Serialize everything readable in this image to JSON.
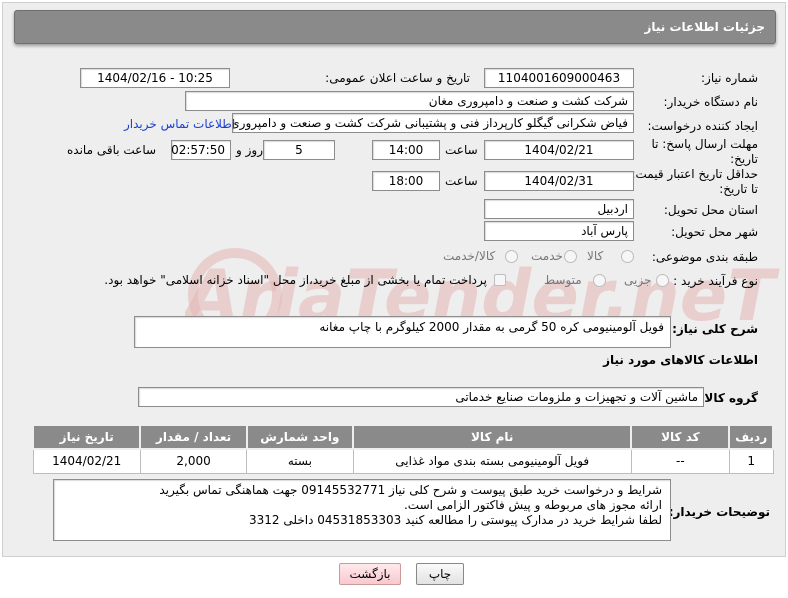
{
  "header": {
    "title": "جزئیات اطلاعات نیاز"
  },
  "fields": {
    "need_number_label": "شماره نیاز:",
    "need_number": "1104001609000463",
    "announce_label": "تاریخ و ساعت اعلان عمومی:",
    "announce_value": "1404/02/16 - 10:25",
    "buyer_org_label": "نام دستگاه خریدار:",
    "buyer_org": "شرکت کشت و صنعت و دامپروری مغان",
    "creator_label": "ایجاد کننده درخواست:",
    "creator": "فیاض شکرانی گیگلو کارپرداز فنی و پشتیبانی شرکت کشت و صنعت و دامپروری",
    "contact_link": "اطلاعات تماس خریدار",
    "deadline_label": "مهلت ارسال پاسخ: تا تاریخ:",
    "deadline_date": "1404/02/21",
    "time_label": "ساعت",
    "deadline_time": "14:00",
    "days_value": "5",
    "days_label": "روز و",
    "remaining_value": "02:57:50",
    "remaining_label": "ساعت باقی مانده",
    "validity_label": "حداقل تاریخ اعتبار قیمت: تا تاریخ:",
    "validity_date": "1404/02/31",
    "validity_time": "18:00",
    "province_label": "استان محل تحویل:",
    "province": "اردبیل",
    "city_label": "شهر محل تحویل:",
    "city": "پارس آباد",
    "category_label": "طبقه بندی موضوعی:",
    "category_options": [
      "کالا",
      "خدمت",
      "کالا/خدمت"
    ],
    "process_label": "نوع فرآیند خرید :",
    "process_options": [
      "جزیی",
      "متوسط"
    ],
    "payment_note": "پرداخت تمام یا بخشی از مبلغ خرید،از محل \"اسناد خزانه اسلامی\" خواهد بود."
  },
  "description": {
    "label": "شرح کلی نیاز:",
    "text": "فویل آلومینیومی کره 50 گرمی  به مقدار 2000 کیلوگرم با چاپ مغانه"
  },
  "goods": {
    "section_title": "اطلاعات کالاهای مورد نیاز",
    "group_label": "گروه کالا:",
    "group_value": "ماشین آلات و تجهیزات و ملزومات صنایع خدماتی",
    "columns": [
      "ردیف",
      "کد کالا",
      "نام کالا",
      "واحد شمارش",
      "تعداد / مقدار",
      "تاریخ نیاز"
    ],
    "rows": [
      {
        "row": "1",
        "code": "--",
        "name": "فویل آلومینیومی بسته بندی مواد غذایی",
        "unit": "بسته",
        "qty": "2,000",
        "date": "1404/02/21"
      }
    ]
  },
  "buyer_notes": {
    "label": "توضیحات خریدار:",
    "lines": [
      "شرایط و درخواست خرید طبق پیوست و شرح کلی نیاز 09145532771 جهت هماهنگی تماس بگیرید",
      "ارائه مجوز های مربوطه و پیش فاکتور الزامی است.",
      "لطفا شرایط خرید در مدارک پیوستی را مطالعه کنید          04531853303   داخلی  3312"
    ]
  },
  "buttons": {
    "print": "چاپ",
    "back": "بازگشت"
  },
  "watermark": "AriaTender.neT",
  "colors": {
    "header": "#8a8a8a",
    "link": "#1a3fd1",
    "watermark": "#e2a9a9"
  }
}
